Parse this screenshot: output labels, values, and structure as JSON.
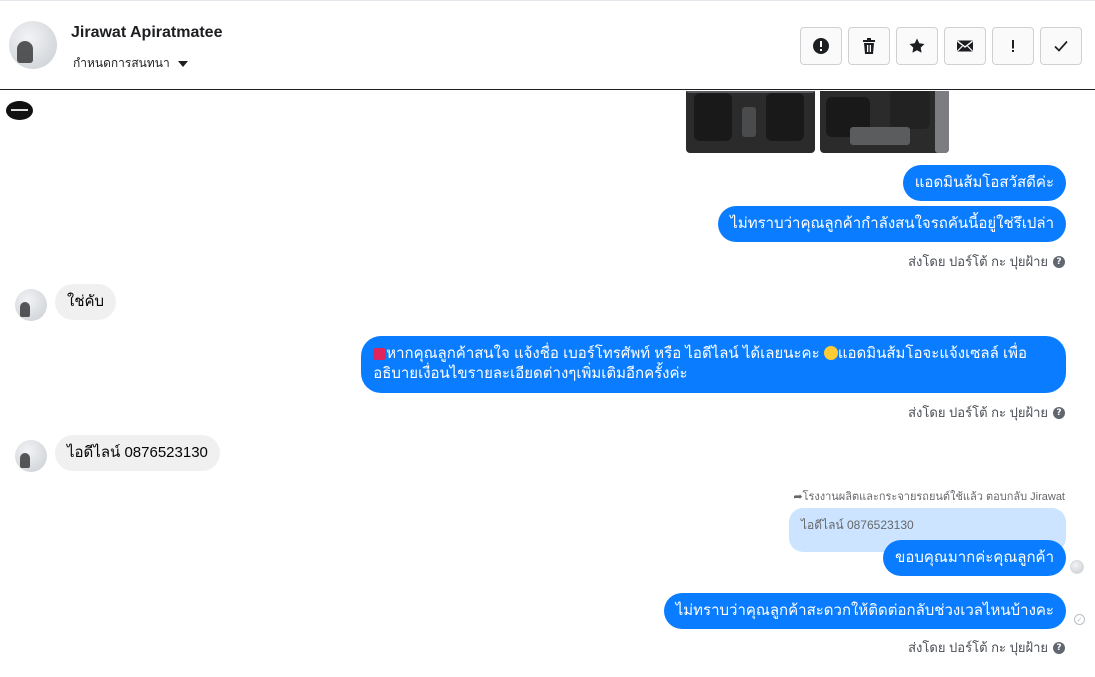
{
  "header": {
    "contact_name": "Jirawat Apiratmatee",
    "conversation_menu": "กำหนดการสนทนา",
    "toolbar": [
      {
        "name": "report-spam-button",
        "icon": "alert-circle-icon"
      },
      {
        "name": "delete-button",
        "icon": "trash-icon"
      },
      {
        "name": "star-button",
        "icon": "star-icon"
      },
      {
        "name": "mark-unread-button",
        "icon": "envelope-icon"
      },
      {
        "name": "follow-up-button",
        "icon": "exclamation-icon"
      },
      {
        "name": "mark-done-button",
        "icon": "check-icon"
      }
    ]
  },
  "messages": {
    "greeting": "แอดมินส้มโอสวัสดีค่ะ",
    "ask_interest": "ไม่ทราบว่าคุณลูกค้ากำลังสนใจรถคันนี้อยู่ใช่รึเปล่า",
    "customer_yes": "ใช่คับ",
    "ask_contact_line1": "หากคุณลูกค้าสนใจ แจ้งชื่อ เบอร์โทรศัพท์ หรือ ไอดีไลน์  ได้เลยนะคะ",
    "ask_contact_line1b": "แอดมินส้มโอจะแจ้งเซลล์   เพื่อ",
    "ask_contact_line2": "อธิบายเงื่อนไขรายละเอียดต่างๆเพิ่มเติมอีกครั้งค่ะ",
    "customer_line_id": "ไอดีไลน์ 0876523130",
    "reply_info": "โรงงานผลิตและกระจายรถยนต์ใช้แล้ว ตอบกลับ Jirawat",
    "quoted_text": "ไอดีไลน์ 0876523130",
    "thanks": "ขอบคุณมากค่ะคุณลูกค้า",
    "ask_time": "ไม่ทราบว่าคุณลูกค้าสะดวกให้ติดต่อกลับช่วงเวลไหนบ้างคะ",
    "sent_by": "ส่งโดย ปอร์โต้ กะ ปุยฝ้าย"
  },
  "colors": {
    "outgoing_bubble": "#0a7cff",
    "incoming_bubble": "#f0f0f0",
    "quoted_bubble": "#cce4ff"
  }
}
